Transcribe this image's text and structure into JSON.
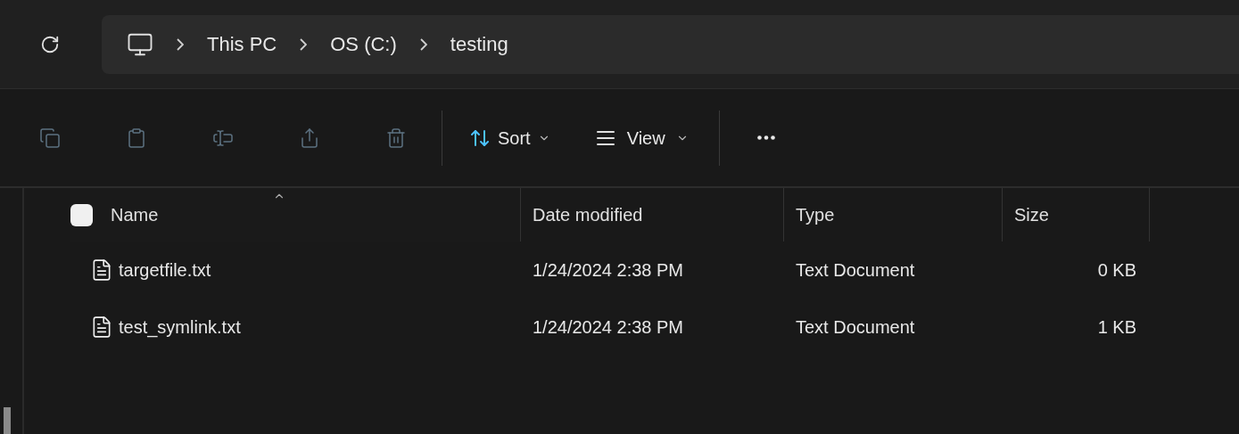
{
  "address_bar": {
    "path": [
      "This PC",
      "OS (C:)",
      "testing"
    ]
  },
  "toolbar": {
    "actions": [
      {
        "kind": "copy",
        "disabled": true
      },
      {
        "kind": "paste",
        "disabled": true
      },
      {
        "kind": "rename",
        "disabled": true
      },
      {
        "kind": "share",
        "disabled": true
      },
      {
        "kind": "delete",
        "disabled": true
      }
    ],
    "sort": {
      "label": "Sort"
    },
    "view": {
      "label": "View"
    }
  },
  "file_list": {
    "select_all": {
      "checked": false
    },
    "columns": [
      {
        "label": "Name",
        "sorted": true
      },
      {
        "label": "Date modified",
        "sorted": false
      },
      {
        "label": "Type",
        "sorted": false
      },
      {
        "label": "Size",
        "sorted": false
      }
    ],
    "rows": [
      {
        "name": "targetfile.txt",
        "date": "1/24/2024 2:38 PM",
        "type": "Text Document",
        "size": "0 KB"
      },
      {
        "name": "test_symlink.txt",
        "date": "1/24/2024 2:38 PM",
        "type": "Text Document",
        "size": "1 KB"
      }
    ]
  }
}
